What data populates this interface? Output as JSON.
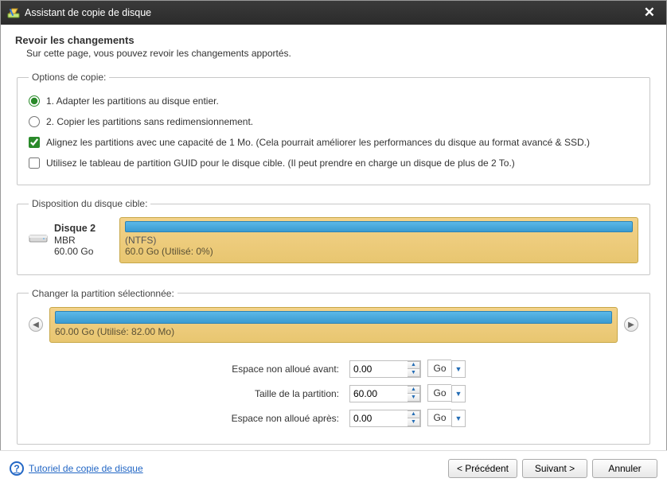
{
  "window": {
    "title": "Assistant de copie de disque"
  },
  "heading": {
    "title": "Revoir les changements",
    "subtitle": "Sur cette page, vous pouvez revoir les changements apportés."
  },
  "options": {
    "legend": "Options de copie:",
    "radio1": "1. Adapter les partitions au disque entier.",
    "radio2": "2. Copier les partitions sans redimensionnement.",
    "check1": "Alignez les partitions avec une capacité de 1 Mo. (Cela pourrait améliorer les performances du disque au format avancé & SSD.)",
    "check2": "Utilisez le tableau de partition GUID pour le disque cible. (Il peut prendre en charge un disque de plus de 2 To.)",
    "radio_selected": 1,
    "check1_checked": true,
    "check2_checked": false
  },
  "target_disk": {
    "legend": "Disposition du disque cible:",
    "name": "Disque 2",
    "scheme": "MBR",
    "size": "60.00 Go",
    "partition_fs": "(NTFS)",
    "partition_usage": "60.0 Go (Utilisé: 0%)"
  },
  "selected_partition": {
    "legend": "Changer la partition sélectionnée:",
    "usage": "60.00 Go (Utilisé: 82.00 Mo)"
  },
  "inputs": {
    "before_label": "Espace non alloué avant:",
    "size_label": "Taille de la partition:",
    "after_label": "Espace non alloué après:",
    "before_value": "0.00",
    "size_value": "60.00",
    "after_value": "0.00",
    "unit": "Go"
  },
  "bottom": {
    "help": "Tutoriel de copie de disque",
    "prev": "< Précédent",
    "next": "Suivant >",
    "cancel": "Annuler"
  }
}
